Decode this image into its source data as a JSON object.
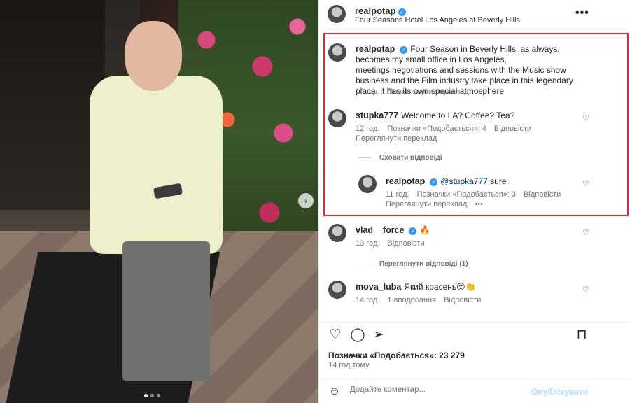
{
  "post": {
    "username": "realpotap",
    "location": "Four Seasons Hotel Los Angeles at Beverly Hills",
    "more_icon": "more-horizontal-icon"
  },
  "media": {
    "next_icon": "chevron-right-icon",
    "carousel_dots": 3,
    "active_dot": 1
  },
  "caption": {
    "username": "realpotap",
    "text": "Four Season in Beverly Hills, as always, becomes my small office in Los Angeles, meetings,negotiations and sessions with the Music show business and the Film industry take place in this legendary place, it has its own special atmosphere",
    "time": "14 год.",
    "translate": "Переглянути переклад"
  },
  "comments": [
    {
      "username": "stupka777",
      "text": "Welcome to LA? Coffee? Tea?",
      "time": "12 год.",
      "likes": "Позначки «Подобається»: 4",
      "reply": "Відповісти",
      "translate": "Переглянути переклад",
      "hide_replies": "Сховати відповіді",
      "replies": [
        {
          "username": "realpotap",
          "mention": "@stupka777",
          "text": "sure",
          "time": "11 год.",
          "likes": "Позначки «Подобається»: 3",
          "reply": "Відповісти",
          "translate": "Переглянути переклад",
          "more": "•••"
        }
      ]
    },
    {
      "username": "vlad__force",
      "text": "🔥",
      "time": "13 год.",
      "reply": "Відповісти",
      "view_replies": "Переглянути відповіді (1)"
    },
    {
      "username": "mova_luba",
      "text": "Який красень😍👏",
      "time": "14 год.",
      "likes": "1 вподобання",
      "reply": "Відповісти"
    }
  ],
  "actions": {
    "like_icon": "heart-icon",
    "comment_icon": "comment-icon",
    "share_icon": "send-icon",
    "save_icon": "bookmark-icon",
    "likes_text": "Позначки «Подобається»: 23 279",
    "time_ago": "14 год тому"
  },
  "composer": {
    "emoji_icon": "emoji-icon",
    "placeholder": "Додайте коментар...",
    "post_label": "Опублікувати"
  },
  "colors": {
    "highlight_border": "#e0282e",
    "verified": "#3897f0",
    "mention": "#00376b",
    "muted": "#737373",
    "post_disabled": "#b3dbff"
  }
}
